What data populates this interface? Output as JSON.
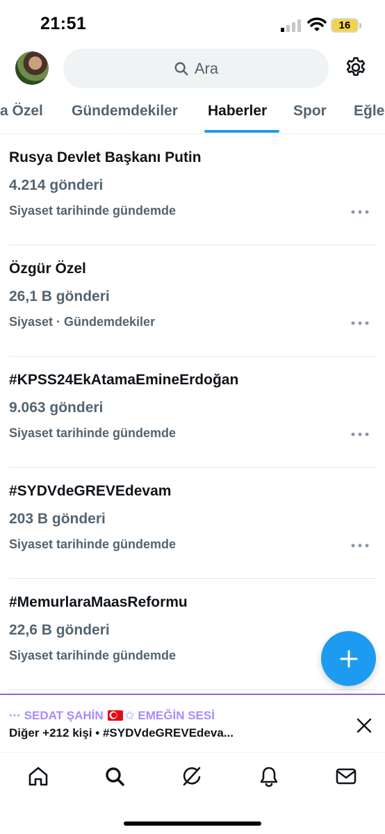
{
  "status_bar": {
    "time": "21:51",
    "battery": "16"
  },
  "header": {
    "search_placeholder": "Ara"
  },
  "tabs": [
    {
      "label": "a Özel"
    },
    {
      "label": "Gündemdekiler"
    },
    {
      "label": "Haberler",
      "active": true
    },
    {
      "label": "Spor"
    },
    {
      "label": "Eğle"
    }
  ],
  "trends": [
    {
      "title": "Rusya Devlet Başkanı Putin",
      "count": "4.214 gönderi",
      "context": "Siyaset tarihinde gündemde"
    },
    {
      "title": "Özgür Özel",
      "count": "26,1 B gönderi",
      "context": "Siyaset · Gündemdekiler"
    },
    {
      "title": "#KPSS24EkAtamaEmineErdoğan",
      "count": "9.063 gönderi",
      "context": "Siyaset tarihinde gündemde"
    },
    {
      "title": "#SYDVdeGREVEdevam",
      "count": "203 B gönderi",
      "context": "Siyaset tarihinde gündemde"
    },
    {
      "title": "#MemurlaraMaasReformu",
      "count": "22,6 B gönderi",
      "context": "Siyaset tarihinde gündemde"
    }
  ],
  "banner": {
    "line1_prefix": "··· SEDAT ŞAHİN",
    "line1_suffix": "EMEĞİN SESİ",
    "line2": "Diğer +212 kişi • #SYDVdeGREVEdeva..."
  },
  "bottom_nav": {
    "icons": [
      "home-icon",
      "search-icon",
      "grok-icon",
      "notifications-icon",
      "messages-icon"
    ]
  },
  "colors": {
    "accent": "#1d9bf0",
    "secondary_text": "#536471",
    "banner_accent": "#8b60e0"
  }
}
